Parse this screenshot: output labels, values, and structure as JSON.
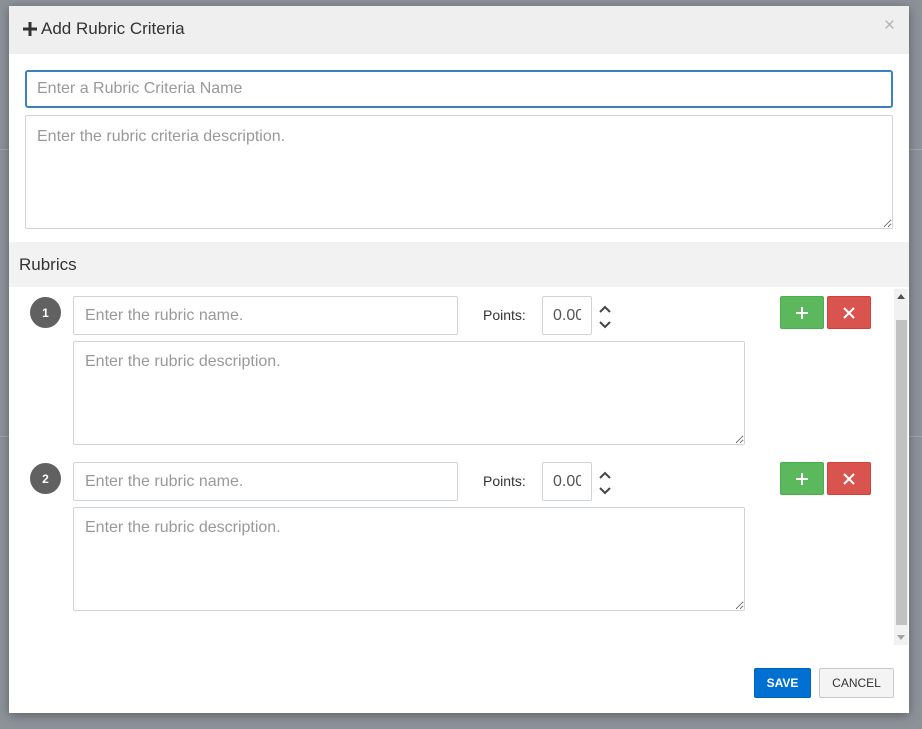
{
  "modal": {
    "title": "Add Rubric Criteria",
    "close_label": "×"
  },
  "criteria": {
    "name_placeholder": "Enter a Rubric Criteria Name",
    "name_value": "",
    "description_placeholder": "Enter the rubric criteria description.",
    "description_value": ""
  },
  "rubrics": {
    "title": "Rubrics",
    "items": [
      {
        "number": "1",
        "name_placeholder": "Enter the rubric name.",
        "points_label": "Points:",
        "points_value": "0.00",
        "description_placeholder": "Enter the rubric description."
      },
      {
        "number": "2",
        "name_placeholder": "Enter the rubric name.",
        "points_label": "Points:",
        "points_value": "0.00",
        "description_placeholder": "Enter the rubric description."
      }
    ]
  },
  "footer": {
    "save_label": "SAVE",
    "cancel_label": "CANCEL"
  },
  "icons": {
    "header": "plus-icon",
    "add": "plus-icon",
    "delete": "x-icon",
    "stepper": "up-down-chevron-icon"
  },
  "colors": {
    "accent": "#0070d2",
    "success": "#5cb85c",
    "danger": "#d9534f",
    "focus_border": "#3c80bd"
  }
}
